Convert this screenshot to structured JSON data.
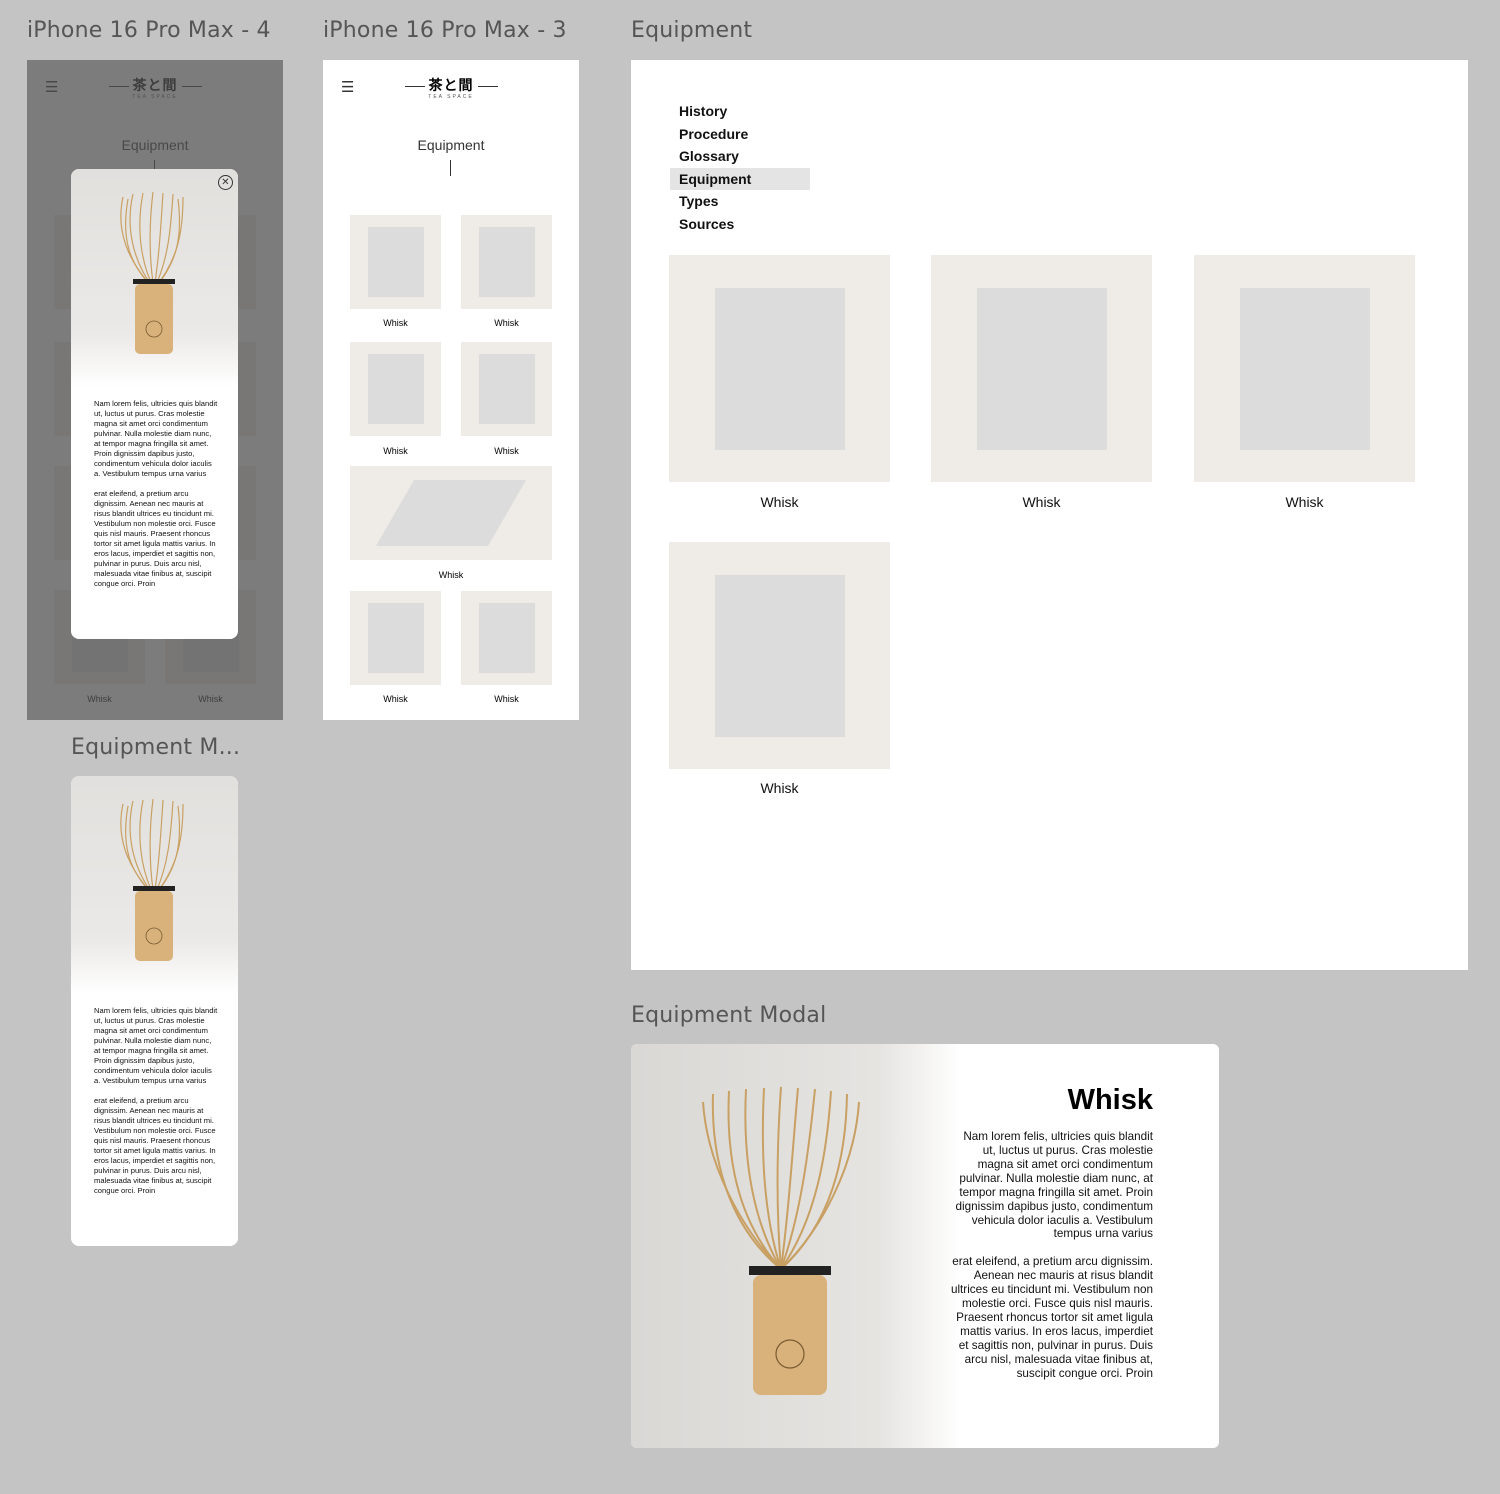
{
  "frames": {
    "phone4_title": "iPhone 16 Pro Max - 4",
    "phone3_title": "iPhone 16 Pro Max - 3",
    "desktop_title": "Equipment",
    "modal_mobile_title": "Equipment M...",
    "modal_desktop_title": "Equipment Modal"
  },
  "logo": {
    "kanji": "茶と間",
    "sub": "TEA SPACE"
  },
  "page_title": "Equipment",
  "nav": {
    "items": [
      "History",
      "Procedure",
      "Glossary",
      "Equipment",
      "Types",
      "Sources"
    ],
    "active": "Equipment"
  },
  "item_label": "Whisk",
  "modal": {
    "title": "Whisk",
    "text_mobile": "Nam lorem felis, ultricies quis blandit ut, luctus ut purus. Cras molestie magna sit amet orci condimentum pulvinar. Nulla molestie diam nunc, at tempor magna fringilla sit amet. Proin dignissim dapibus justo, condimentum vehicula dolor iaculis a. Vestibulum tempus urna varius\n\n erat eleifend, a pretium arcu dignissim. Aenean nec mauris at risus blandit ultrices eu tincidunt mi. Vestibulum non molestie orci. Fusce quis nisl mauris. Praesent rhoncus tortor sit amet ligula mattis varius. In eros lacus, imperdiet et sagittis non, pulvinar in purus. Duis arcu nisl, malesuada vitae finibus at, suscipit congue orci. Proin",
    "text_desktop": "Nam lorem felis, ultricies quis blandit ut, luctus ut purus. Cras molestie magna sit amet orci condimentum pulvinar. Nulla molestie diam nunc, at tempor magna fringilla sit amet. Proin dignissim dapibus justo, condimentum vehicula dolor iaculis a. Vestibulum tempus urna varius\n\nerat eleifend, a pretium arcu dignissim. Aenean nec mauris at risus blandit ultrices eu tincidunt mi. Vestibulum non molestie orci. Fusce quis nisl mauris. Praesent rhoncus tortor sit amet ligula mattis varius. In eros lacus, imperdiet et sagittis non, pulvinar in purus. Duis arcu nisl, malesuada vitae finibus at, suscipit congue orci. Proin"
  },
  "icons": {
    "menu": "hamburger-menu-icon",
    "close": "close-circle-icon"
  },
  "colors": {
    "canvas": "#c4c4c4",
    "card": "#efebe6",
    "overlay": "#505050",
    "nav_active": "#e4e4e4"
  }
}
